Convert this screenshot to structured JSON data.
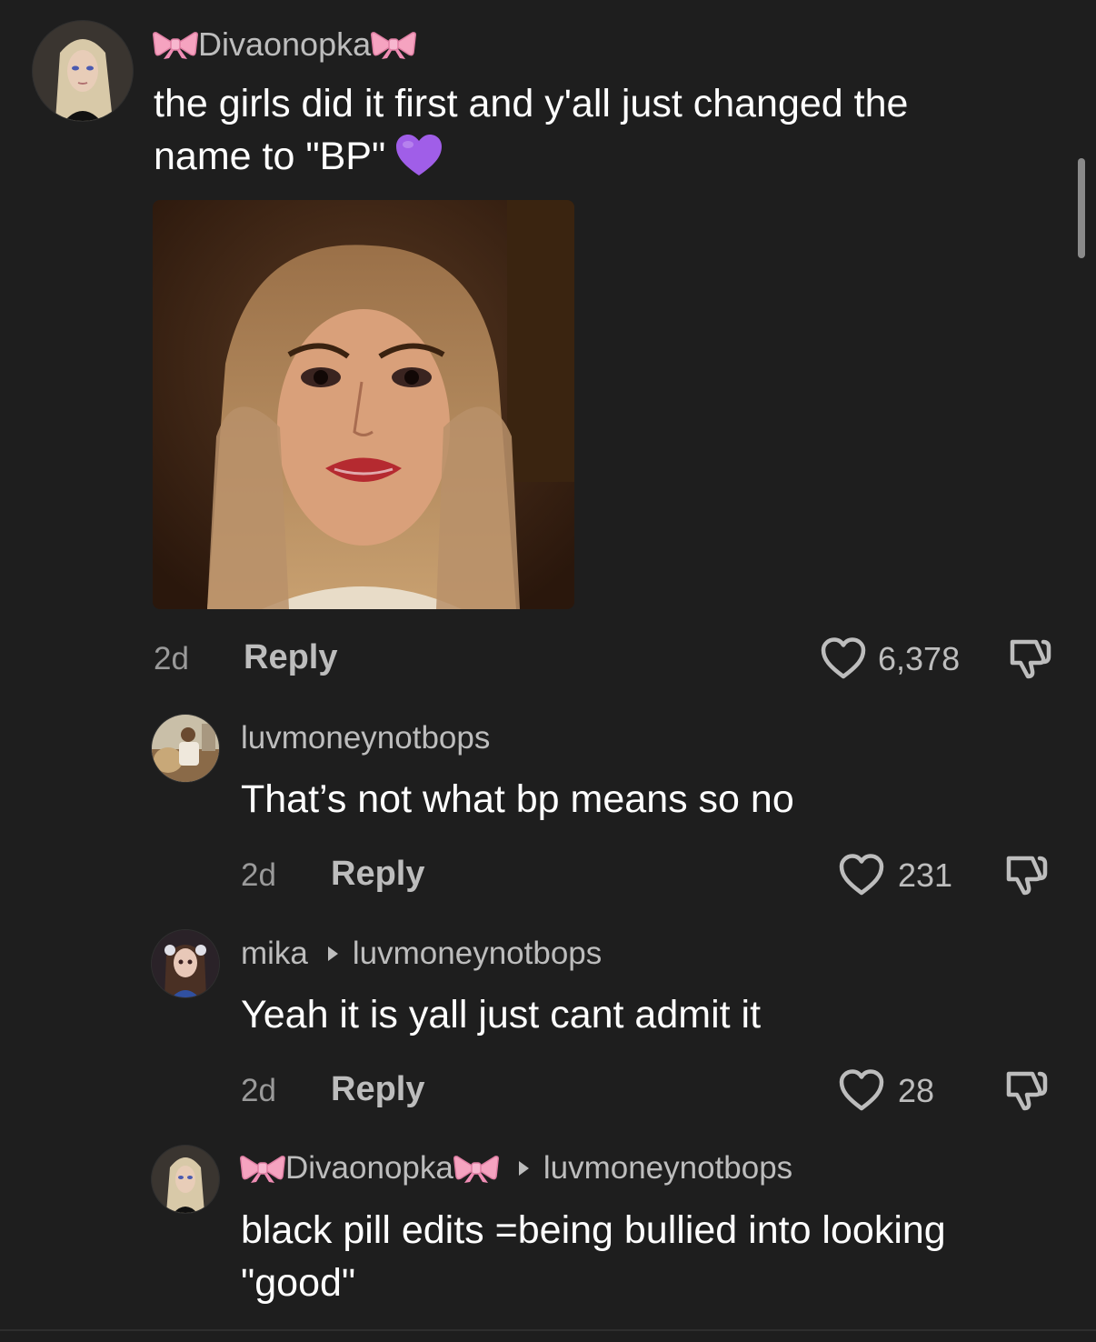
{
  "comments": [
    {
      "username": "Divaonopka",
      "reply_to": "",
      "text_line1": "the girls did it first and y'all just changed the",
      "text_line2": "name to \"BP\"",
      "emoji": "purple-heart",
      "has_image": true,
      "time": "2d",
      "reply_label": "Reply",
      "likes": "6,378"
    },
    {
      "username": "luvmoneynotbops",
      "reply_to": "",
      "text": "That’s not what bp means so no",
      "time": "2d",
      "reply_label": "Reply",
      "likes": "231"
    },
    {
      "username": "mika",
      "reply_to": "luvmoneynotbops",
      "text": "Yeah it is yall just cant admit it",
      "time": "2d",
      "reply_label": "Reply",
      "likes": "28"
    },
    {
      "username": "Divaonopka",
      "reply_to": "luvmoneynotbops",
      "text_line1": "black pill edits =being bullied into looking",
      "text_line2": "\"good\""
    }
  ],
  "colors": {
    "background": "#1e1e1e",
    "text_primary": "#ffffff",
    "text_secondary": "#bdbdbd",
    "text_muted": "#9a9a9a",
    "bow_pink": "#f5a3c0",
    "heart_purple": "#a05ee8"
  },
  "icons": {
    "like": "heart-outline-icon",
    "dislike": "thumbs-down-icon",
    "emoji": "purple-heart-icon",
    "decoration": "pink-bow-icon"
  }
}
